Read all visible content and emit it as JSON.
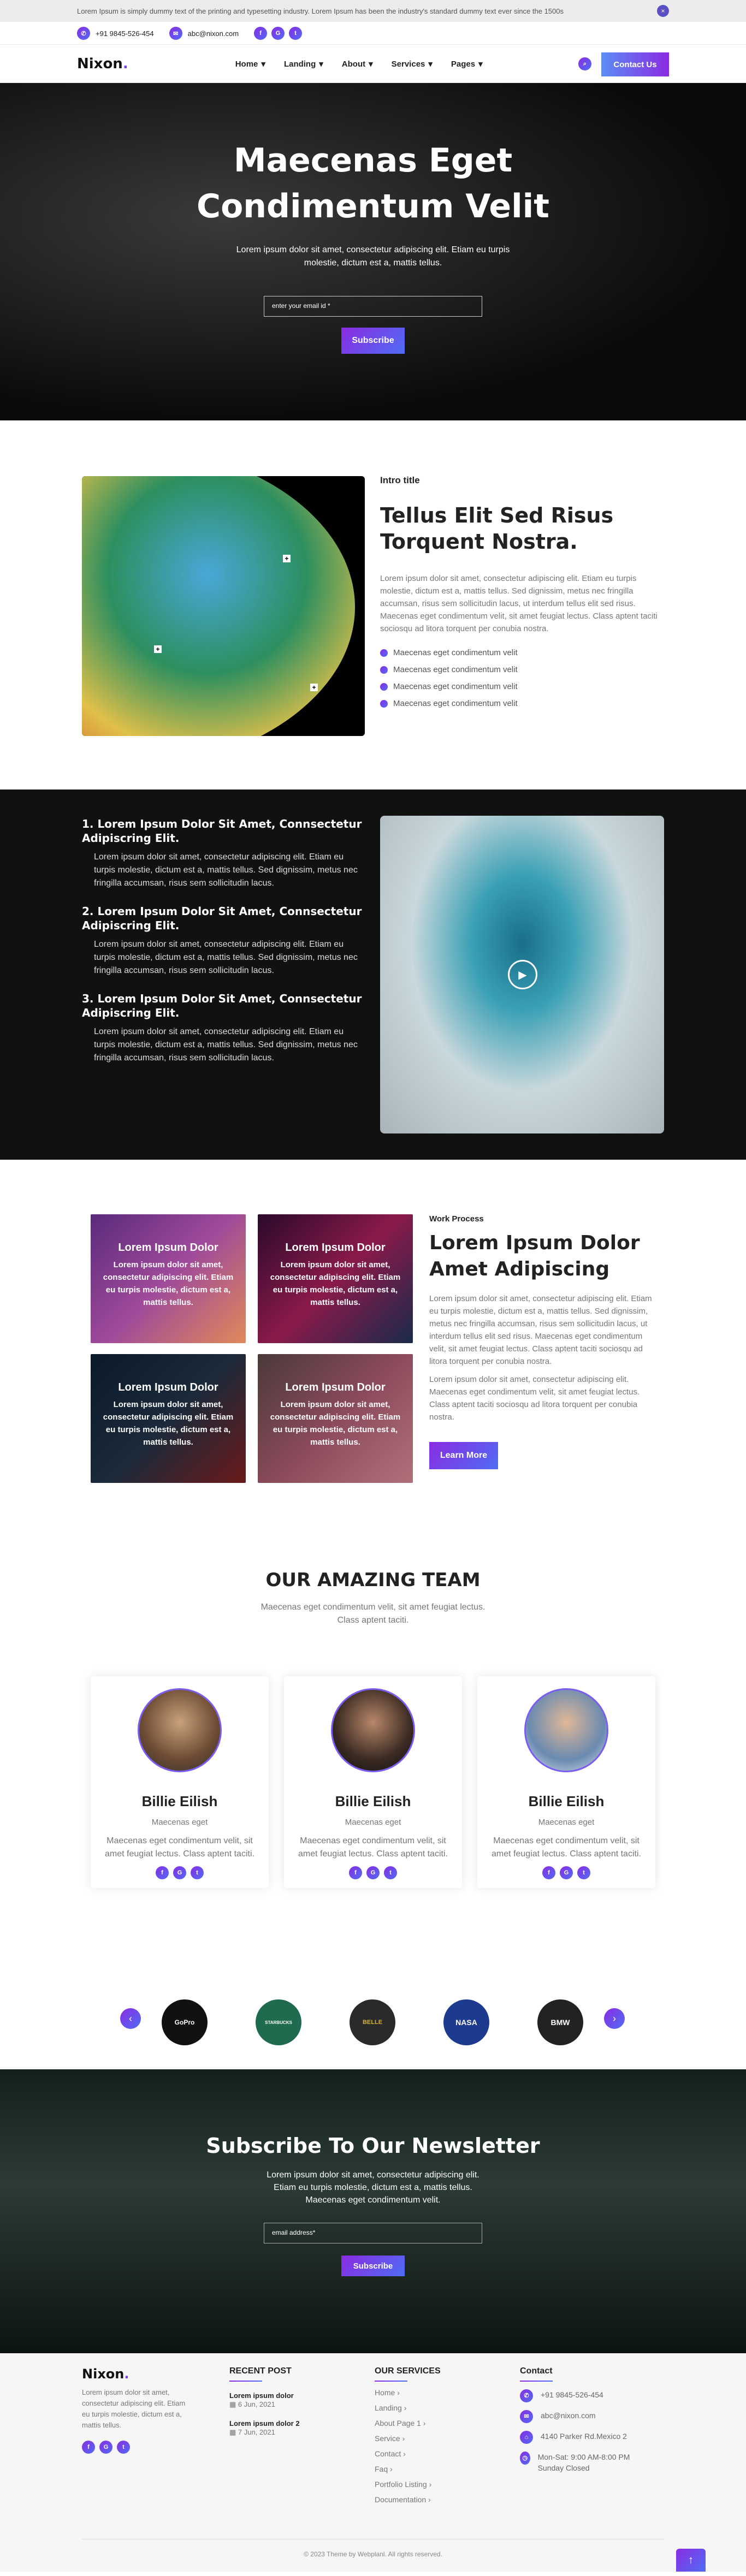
{
  "announcement": {
    "text": "Lorem Ipsum is simply dummy text of the printing and typesetting industry. Lorem Ipsum has been the industry's standard dummy text ever since the 1500s",
    "close_glyph": "×"
  },
  "contact_bar": {
    "phone": "+91 9845-526-454",
    "email": "abc@nixon.com",
    "socials": [
      "f",
      "G",
      "t"
    ]
  },
  "nav": {
    "logo": "Nixon",
    "logo_dot": ".",
    "items": [
      "Home",
      "Landing",
      "About",
      "Services",
      "Pages"
    ],
    "contact_label": "Contact Us",
    "search_glyph": "⌕"
  },
  "hero": {
    "title": "Maecenas Eget Condimentum Velit",
    "text": "Lorem ipsum dolor sit amet, consectetur adipiscing elit. Etiam eu turpis molestie, dictum est a, mattis tellus.",
    "email_placeholder": "enter your email id *",
    "subscribe_label": "Subscribe"
  },
  "intro": {
    "eyebrow": "Intro title",
    "title": "Tellus Elit Sed Risus Torquent Nostra.",
    "text": "Lorem ipsum dolor sit amet, consectetur adipiscing elit. Etiam eu turpis molestie, dictum est a, mattis tellus. Sed dignissim, metus nec fringilla accumsan, risus sem sollicitudin lacus, ut interdum tellus elit sed risus. Maecenas eget condimentum velit, sit amet feugiat lectus. Class aptent taciti sociosqu ad litora torquent per conubia nostra.",
    "list": [
      "Maecenas eget condimentum velit",
      "Maecenas eget condimentum velit",
      "Maecenas eget condimentum velit",
      "Maecenas eget condimentum velit"
    ]
  },
  "features": {
    "items": [
      {
        "title": "1. Lorem Ipsum Dolor Sit Amet, Connsectetur Adipiscring Elit.",
        "text": "Lorem ipsum dolor sit amet, consectetur adipiscing elit. Etiam eu turpis molestie, dictum est a, mattis tellus. Sed dignissim, metus nec fringilla accumsan, risus sem sollicitudin lacus."
      },
      {
        "title": "2. Lorem Ipsum Dolor Sit Amet, Connsectetur Adipiscring Elit.",
        "text": "Lorem ipsum dolor sit amet, consectetur adipiscing elit. Etiam eu turpis molestie, dictum est a, mattis tellus. Sed dignissim, metus nec fringilla accumsan, risus sem sollicitudin lacus."
      },
      {
        "title": "3. Lorem Ipsum Dolor Sit Amet, Connsectetur Adipiscring Elit.",
        "text": "Lorem ipsum dolor sit amet, consectetur adipiscing elit. Etiam eu turpis molestie, dictum est a, mattis tellus. Sed dignissim, metus nec fringilla accumsan, risus sem sollicitudin lacus."
      }
    ]
  },
  "work": {
    "cards": [
      {
        "title": "Lorem Ipsum Dolor",
        "text": "Lorem ipsum dolor sit amet, consectetur adipiscing elit. Etiam eu turpis molestie, dictum est a, mattis tellus."
      },
      {
        "title": "Lorem Ipsum Dolor",
        "text": "Lorem ipsum dolor sit amet, consectetur adipiscing elit. Etiam eu turpis molestie, dictum est a, mattis tellus."
      },
      {
        "title": "Lorem Ipsum Dolor",
        "text": "Lorem ipsum dolor sit amet, consectetur adipiscing elit. Etiam eu turpis molestie, dictum est a, mattis tellus."
      },
      {
        "title": "Lorem Ipsum Dolor",
        "text": "Lorem ipsum dolor sit amet, consectetur adipiscing elit. Etiam eu turpis molestie, dictum est a, mattis tellus."
      }
    ],
    "eyebrow": "Work Process",
    "title": "Lorem Ipsum Dolor Amet Adipiscing",
    "text1": "Lorem ipsum dolor sit amet, consectetur adipiscing elit. Etiam eu turpis molestie, dictum est a, mattis tellus. Sed dignissim, metus nec fringilla accumsan, risus sem sollicitudin lacus, ut interdum tellus elit sed risus. Maecenas eget condimentum velit, sit amet feugiat lectus. Class aptent taciti sociosqu ad litora torquent per conubia nostra.",
    "text2": "Lorem ipsum dolor sit amet, consectetur adipiscing elit. Maecenas eget condimentum velit, sit amet feugiat lectus. Class aptent taciti sociosqu ad litora torquent per conubia nostra.",
    "button": "Learn More"
  },
  "team": {
    "title": "OUR AMAZING TEAM",
    "lead": "Maecenas eget condimentum velit, sit amet feugiat lectus. Class aptent taciti.",
    "members": [
      {
        "name": "Billie Eilish",
        "role": "Maecenas eget",
        "desc": "Maecenas eget condimentum velit, sit amet feugiat lectus. Class aptent taciti."
      },
      {
        "name": "Billie Eilish",
        "role": "Maecenas eget",
        "desc": "Maecenas eget condimentum velit, sit amet feugiat lectus. Class aptent taciti."
      },
      {
        "name": "Billie Eilish",
        "role": "Maecenas eget",
        "desc": "Maecenas eget condimentum velit, sit amet feugiat lectus. Class aptent taciti."
      }
    ]
  },
  "brands": {
    "items": [
      "GoPro",
      "STARBUCKS",
      "BELLE",
      "NASA",
      "BMW"
    ],
    "prev": "‹",
    "next": "›"
  },
  "newsletter": {
    "title": "Subscribe To Our Newsletter",
    "text": "Lorem ipsum dolor sit amet, consectetur adipiscing elit. Etiam eu turpis molestie, dictum est a, mattis tellus. Maecenas eget condimentum velit.",
    "placeholder": "email address*",
    "button": "Subscribe"
  },
  "footer": {
    "about": "Lorem ipsum dolor sit amet, consectetur adipiscing elit. Etiam eu turpis molestie, dictum est a, mattis tellus.",
    "recent_title": "RECENT POST",
    "posts": [
      {
        "title": "Lorem ipsum dolor",
        "date": "6 Jun, 2021"
      },
      {
        "title": "Lorem ipsum dolor 2",
        "date": "7 Jun, 2021"
      }
    ],
    "services_title": "OUR SERVICES",
    "services": [
      "Home",
      "Landing",
      "About Page 1",
      "Service",
      "Contact",
      "Faq",
      "Portfolio Listing",
      "Documentation"
    ],
    "contact_title": "Contact",
    "contact": [
      "+91 9845-526-454",
      "abc@nixon.com",
      "4140 Parker Rd.Mexico 2",
      "Mon-Sat: 9:00 AM-8:00 PM Sunday Closed"
    ],
    "copyright": "© 2023 Theme by Webplanl. All rights reserved.",
    "top_glyph": "↑"
  }
}
